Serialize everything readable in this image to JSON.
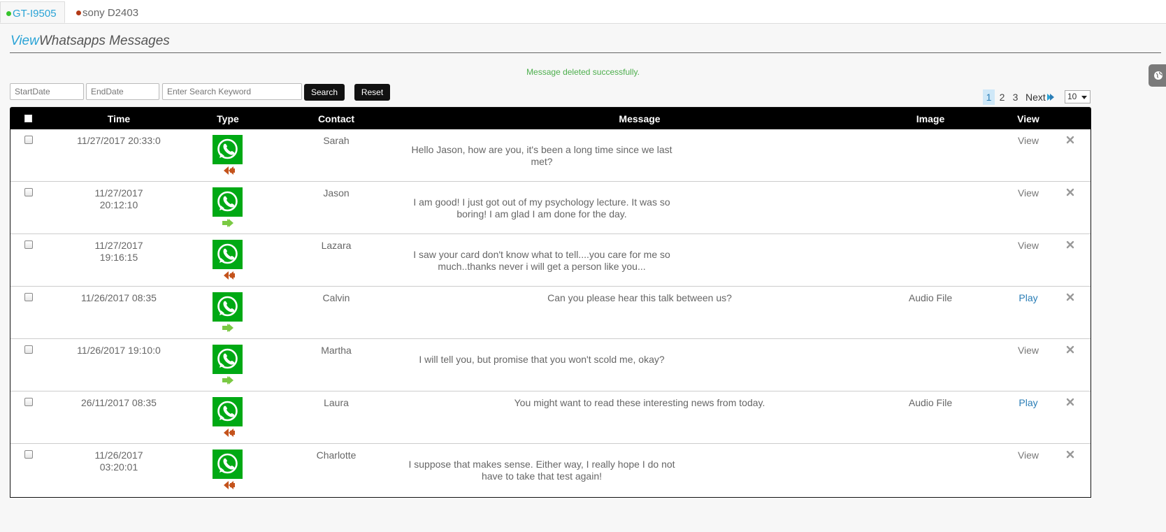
{
  "tabs": [
    {
      "label": "GT-I9505",
      "status": "online",
      "dot_color": "#36c42c",
      "active": true
    },
    {
      "label": "sony D2403",
      "status": "offline",
      "dot_color": "#b33a16",
      "active": false
    }
  ],
  "page_title": {
    "highlight": "View",
    "rest": "Whatsapps Messages"
  },
  "status_message": "Message deleted successfully.",
  "filters": {
    "start_date_placeholder": "StartDate",
    "end_date_placeholder": "EndDate",
    "keyword_placeholder": "Enter Search Keyword",
    "search_label": "Search",
    "reset_label": "Reset"
  },
  "pagination": {
    "pages": [
      "1",
      "2",
      "3"
    ],
    "current": "1",
    "next_label": "Next",
    "page_size": "10"
  },
  "table": {
    "columns": [
      "",
      "Time",
      "Type",
      "Contact",
      "Message",
      "Image",
      "View"
    ],
    "rows": [
      {
        "time": "11/27/2017 20:33:0",
        "type_icon": "whatsapp-icon",
        "direction": "incoming",
        "contact": "Sarah",
        "message_lines": [
          "Hello Jason, how are you, it's been a long time since we last",
          "met?"
        ],
        "image": "",
        "view": "View"
      },
      {
        "time": "11/27/2017 20:12:10",
        "type_icon": "whatsapp-icon",
        "direction": "outgoing",
        "contact": "Jason",
        "message_lines": [
          "I am good! I just got out of my psychology lecture. It was so",
          "boring! I am glad I am done for the day."
        ],
        "image": "",
        "view": "View"
      },
      {
        "time": "11/27/2017 19:16:15",
        "type_icon": "whatsapp-icon",
        "direction": "incoming",
        "contact": "Lazara",
        "message_lines": [
          "I saw your card don't know what to tell....you care for me so",
          "much..thanks never i will get a person like you..."
        ],
        "image": "",
        "view": "View"
      },
      {
        "time": "11/26/2017 08:35",
        "type_icon": "whatsapp-icon",
        "direction": "outgoing",
        "contact": "Calvin",
        "message_lines": [
          "Can you please hear this talk between us?"
        ],
        "image": "Audio File",
        "view": "Play"
      },
      {
        "time": "11/26/2017 19:10:0",
        "type_icon": "whatsapp-icon",
        "direction": "outgoing",
        "contact": "Martha",
        "message_lines": [
          "I will tell you, but promise that you won't scold me, okay?"
        ],
        "image": "",
        "view": "View"
      },
      {
        "time": "26/11/2017 08:35",
        "type_icon": "whatsapp-icon",
        "direction": "incoming",
        "contact": "Laura",
        "message_lines": [
          "You might want to read these interesting news from today."
        ],
        "image": "Audio File",
        "view": "Play"
      },
      {
        "time": "11/26/2017 03:20:01",
        "type_icon": "whatsapp-icon",
        "direction": "incoming",
        "contact": "Charlotte",
        "message_lines": [
          "I suppose that makes sense. Either way, I really hope I do not",
          "have to take that test again!"
        ],
        "image": "",
        "view": "View"
      }
    ]
  },
  "colors": {
    "accent": "#2aa3d6",
    "success": "#4cae4c",
    "whatsapp": "#00a914",
    "incoming_arrow": "#c4531c",
    "outgoing_arrow": "#7ac943"
  }
}
